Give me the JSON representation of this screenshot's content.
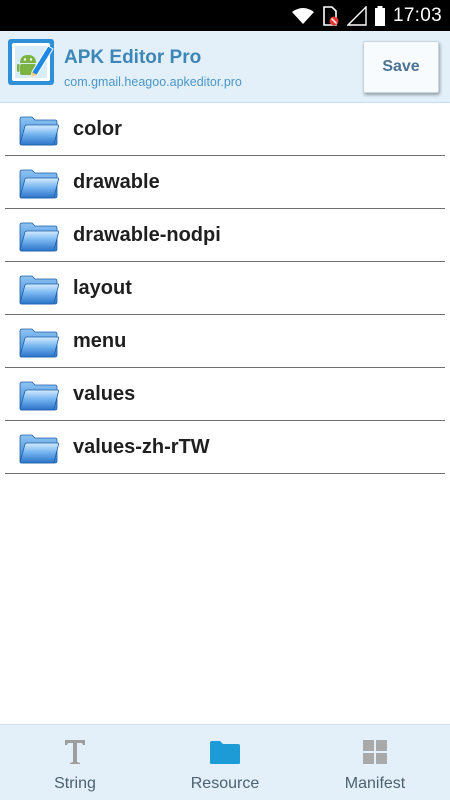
{
  "status_bar": {
    "time": "17:03",
    "icons": [
      "wifi-icon",
      "sim-blocked-icon",
      "signal-icon",
      "battery-icon"
    ]
  },
  "header": {
    "app_title": "APK Editor Pro",
    "package_name": "com.gmail.heagoo.apkeditor.pro",
    "save_label": "Save",
    "icon": "pencil-android-icon"
  },
  "folders": [
    {
      "label": "color"
    },
    {
      "label": "drawable"
    },
    {
      "label": "drawable-nodpi"
    },
    {
      "label": "layout"
    },
    {
      "label": "menu"
    },
    {
      "label": "values"
    },
    {
      "label": "values-zh-rTW"
    }
  ],
  "bottom_nav": {
    "tabs": [
      {
        "label": "String",
        "icon": "text-t-icon",
        "active": false
      },
      {
        "label": "Resource",
        "icon": "folder-icon",
        "active": true
      },
      {
        "label": "Manifest",
        "icon": "grid-icon",
        "active": false
      }
    ]
  },
  "colors": {
    "header_bg": "#e3f0fa",
    "title_blue": "#3d86b8",
    "active_tab": "#1d9bd6",
    "inactive_tab": "#a9a9a9"
  }
}
